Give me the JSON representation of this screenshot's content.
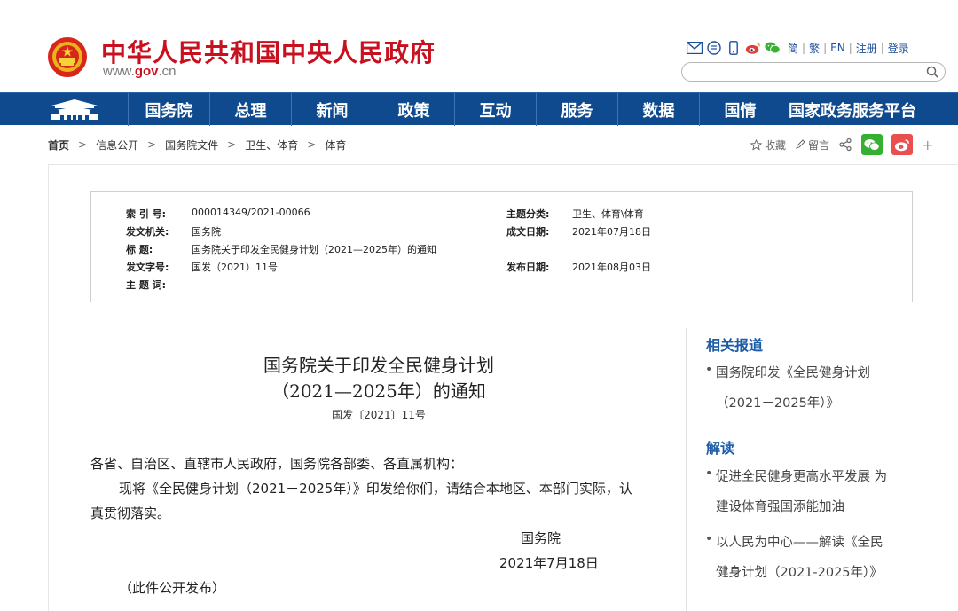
{
  "header": {
    "site_name": "中华人民共和国中央人民政府",
    "site_url_prefix": "www.",
    "site_url_brand": "gov",
    "site_url_suffix": ".cn",
    "tools": {
      "simplified": "简",
      "traditional": "繁",
      "english": "EN",
      "register": "注册",
      "login": "登录"
    },
    "search_placeholder": ""
  },
  "nav": {
    "items": [
      "国务院",
      "总理",
      "新闻",
      "政策",
      "互动",
      "服务",
      "数据",
      "国情",
      "国家政务服务平台"
    ]
  },
  "breadcrumb": {
    "items": [
      "首页",
      "信息公开",
      "国务院文件",
      "卫生、体育",
      "体育"
    ],
    "separator": ">"
  },
  "page_tools": {
    "favorite": "收藏",
    "comment": "留言"
  },
  "info": {
    "index_no_label": "索 引 号:",
    "index_no": "000014349/2021-00066",
    "topic_label": "主题分类:",
    "topic": "卫生、体育\\体育",
    "issuer_label": "发文机关:",
    "issuer": "国务院",
    "date_written_label": "成文日期:",
    "date_written": "2021年07月18日",
    "title_label": "标 题:",
    "title": "国务院关于印发全民健身计划（2021—2025年）的通知",
    "doc_no_label": "发文字号:",
    "doc_no": "国发（2021）11号",
    "date_published_label": "发布日期:",
    "date_published": "2021年08月03日",
    "keywords_label": "主 题 词:",
    "keywords": ""
  },
  "article": {
    "title_line1": "国务院关于印发全民健身计划",
    "title_line2": "（2021—2025年）的通知",
    "doc_no": "国发〔2021〕11号",
    "salutation": "各省、自治区、直辖市人民政府，国务院各部委、各直属机构：",
    "body_line1": "现将《全民健身计划（2021－2025年）》印发给你们，请结合本地区、本部门实际，认",
    "body_line2": "真贯彻落实。",
    "signature": "国务院",
    "sign_date": "2021年7月18日",
    "footnote": "（此件公开发布）"
  },
  "sidebar": {
    "related_title": "相关报道",
    "related": [
      {
        "line1": "国务院印发《全民健身计划",
        "line2": "（2021－2025年）》"
      }
    ],
    "interpret_title": "解读",
    "interpret": [
      {
        "line1": "促进全民健身更高水平发展 为",
        "line2": "建设体育强国添能加油"
      },
      {
        "line1": "以人民为中心——解读《全民",
        "line2": "健身计划（2021-2025年）》"
      }
    ]
  },
  "colors": {
    "brand_red": "#c8101e",
    "nav_blue": "#0f4a8f",
    "link_blue": "#1d5ba6",
    "wechat_green": "#36b032",
    "weibo_red": "#e94f4f"
  }
}
